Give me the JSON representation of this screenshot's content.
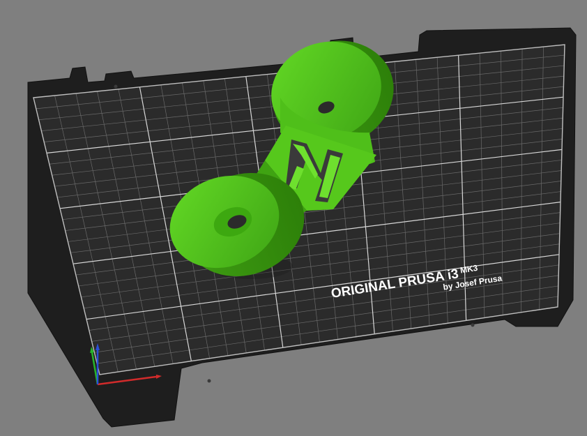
{
  "colors": {
    "background": "#7f7f7f",
    "bed_frame": "#1e1e1e",
    "bed_surface": "#2b2b2b",
    "grid_minor": "#6a6a6a",
    "grid_major": "#d8d8d8",
    "model": "#5fd321",
    "axis_x": "#d12b2b",
    "axis_y": "#27b52b",
    "axis_z": "#2a4fd8"
  },
  "bed": {
    "brand_line": "ORIGINAL PRUSA i3",
    "model_name": "MK3",
    "byline": "by Josef Prusa"
  },
  "object": {
    "shape": "spool-holder",
    "embossed_letter": "M"
  },
  "axes": [
    "X",
    "Y",
    "Z"
  ]
}
